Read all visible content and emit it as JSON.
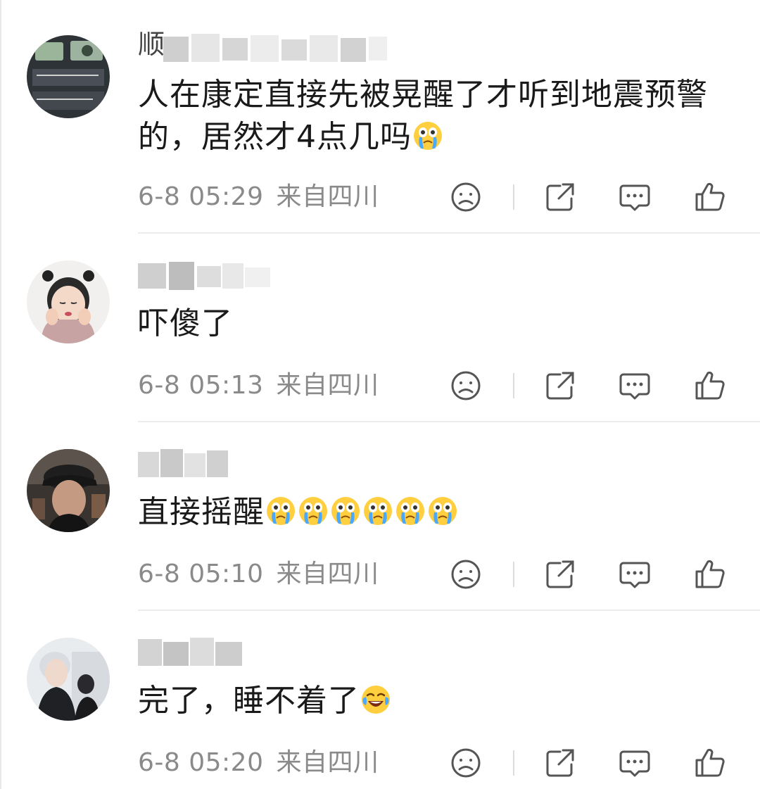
{
  "comments": [
    {
      "username_prefix": "顺",
      "text": "人在康定直接先被晃醒了才听到地震预警的，居然才4点几吗",
      "emojis": [
        "crying-face"
      ],
      "time": "6-8 05:29",
      "location": "来自四川"
    },
    {
      "username_prefix": "",
      "text": "吓傻了",
      "emojis": [],
      "time": "6-8 05:13",
      "location": "来自四川"
    },
    {
      "username_prefix": "",
      "text": "直接摇醒",
      "emojis": [
        "crying-face",
        "crying-face",
        "crying-face",
        "crying-face",
        "crying-face",
        "crying-face"
      ],
      "time": "6-8 05:10",
      "location": "来自四川"
    },
    {
      "username_prefix": "",
      "text": "完了，睡不着了",
      "emojis": [
        "laughing-tears-face"
      ],
      "time": "6-8 05:20",
      "location": "来自四川"
    }
  ],
  "actions": [
    "sad-face-icon",
    "share-icon",
    "comment-icon",
    "like-icon"
  ],
  "colors": {
    "meta_text": "#8a8a8a",
    "icon": "#555555",
    "divider": "#ececec"
  }
}
